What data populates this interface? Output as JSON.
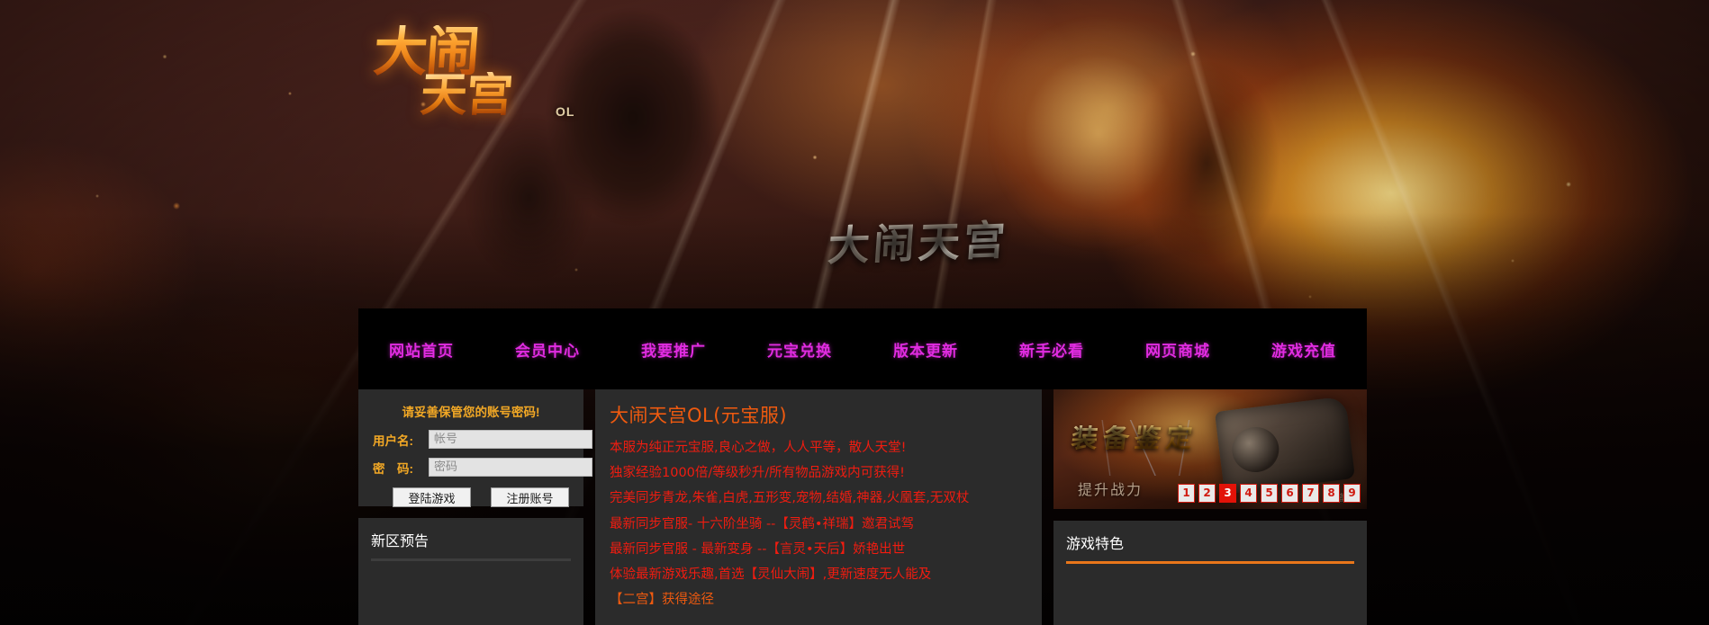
{
  "site": {
    "logo_main": "大闹",
    "logo_sub": "天宫",
    "logo_suffix": "OL",
    "banner_title": "大闹天宫"
  },
  "nav": {
    "items": [
      {
        "label": "网站首页",
        "name": "nav-home"
      },
      {
        "label": "会员中心",
        "name": "nav-member-center"
      },
      {
        "label": "我要推广",
        "name": "nav-promote"
      },
      {
        "label": "元宝兑换",
        "name": "nav-ingot-exchange"
      },
      {
        "label": "版本更新",
        "name": "nav-version-update"
      },
      {
        "label": "新手必看",
        "name": "nav-beginner-guide"
      },
      {
        "label": "网页商城",
        "name": "nav-web-store"
      },
      {
        "label": "游戏充值",
        "name": "nav-recharge"
      }
    ]
  },
  "login": {
    "tip": "请妥善保管您的账号密码!",
    "username_label": "用户名:",
    "username_placeholder": "帐号",
    "username_value": "",
    "password_label": "密　码:",
    "password_placeholder": "密码",
    "password_value": "",
    "login_button": "登陆游戏",
    "register_button": "注册账号"
  },
  "left_section": {
    "title": "新区预告"
  },
  "article": {
    "title": "大闹天宫OL(元宝服)",
    "lines": [
      "本服为纯正元宝服,良心之做，人人平等，散人天堂!",
      "独家经验1000倍/等级秒升/所有物品游戏内可获得!",
      "完美同步青龙,朱雀,白虎,五形变,宠物,结婚,神器,火凰套,无双杖",
      "最新同步官服- 十六阶坐骑 --【灵鹤•祥瑞】邀君试驾",
      "最新同步官服 - 最新变身 --【言灵•天后】娇艳出世",
      "体验最新游戏乐趣,首选【灵仙大闹】,更新速度无人能及",
      "【二宫】获得途径"
    ]
  },
  "equip_banner": {
    "title": "装备鉴定",
    "subtitle": "提升战力",
    "watermark": "装备",
    "pages": [
      "1",
      "2",
      "3",
      "4",
      "5",
      "6",
      "7",
      "8",
      "9"
    ],
    "active_page": "3"
  },
  "right_section": {
    "title": "游戏特色"
  },
  "colors": {
    "nav_text": "#e12ce1",
    "nav_bg": "#000000",
    "panel_bg": "#2b2b2b",
    "accent_orange": "#e8761a",
    "article_red": "#f01c10",
    "article_title": "#ef5a0f",
    "label_gold": "#f2a825",
    "pager_red": "#e21208"
  }
}
